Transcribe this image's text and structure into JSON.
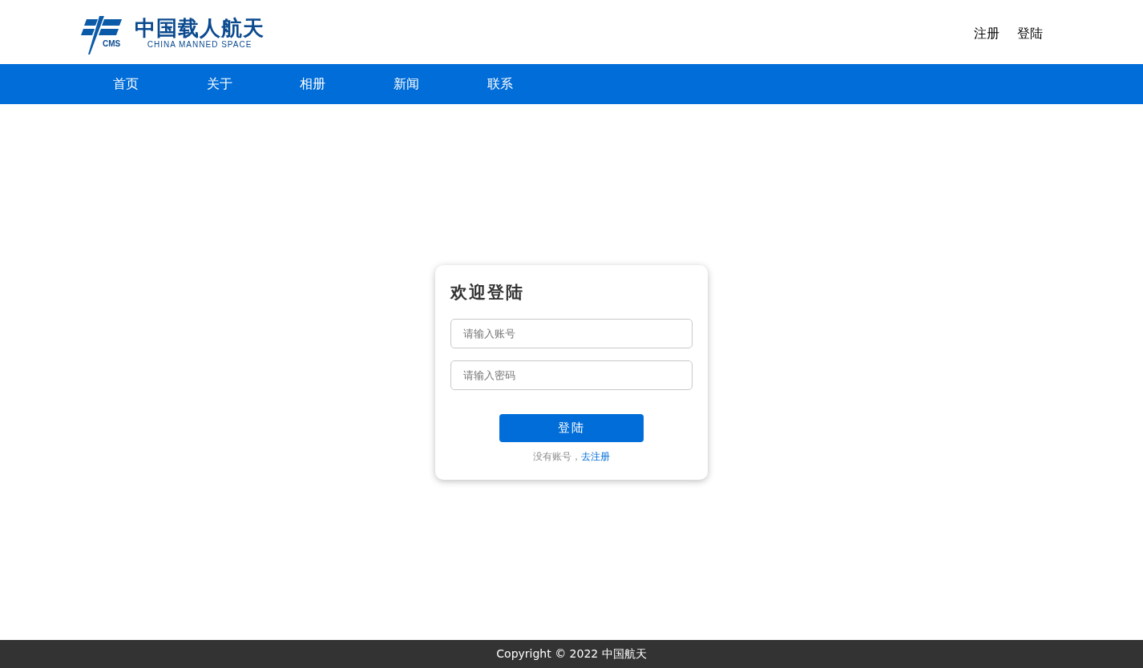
{
  "header": {
    "logo": {
      "mark": "CMS",
      "title": "中国载人航天",
      "subtitle": "CHINA MANNED SPACE"
    },
    "links": [
      {
        "label": "注册"
      },
      {
        "label": "登陆"
      }
    ]
  },
  "nav": {
    "items": [
      {
        "label": "首页"
      },
      {
        "label": "关于"
      },
      {
        "label": "相册"
      },
      {
        "label": "新闻"
      },
      {
        "label": "联系"
      }
    ]
  },
  "login_card": {
    "title": "欢迎登陆",
    "fields": [
      {
        "placeholder": "请输入账号"
      },
      {
        "placeholder": "请输入密码"
      }
    ],
    "button": "登陆",
    "prompt": "没有账号，",
    "register_link": "去注册"
  },
  "footer": {
    "text": "Copyright © 2022 中国航天"
  }
}
